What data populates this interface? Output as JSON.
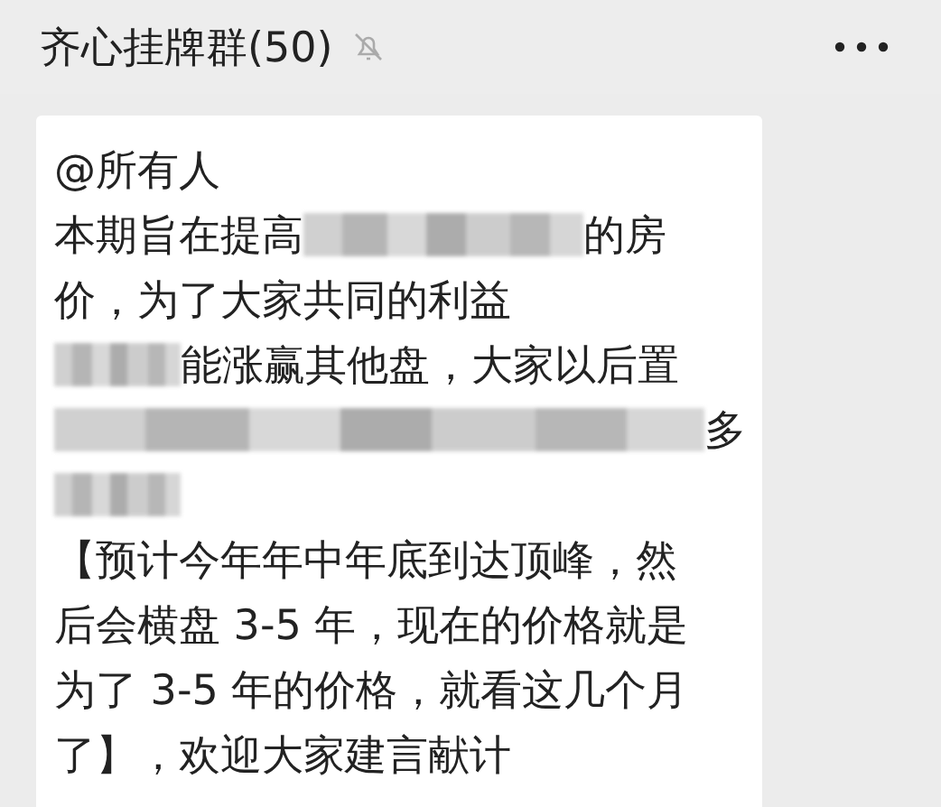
{
  "header": {
    "title": "齐心挂牌群(50)",
    "muted": true
  },
  "message": {
    "lines": [
      [
        {
          "kind": "text",
          "text": "@所有人"
        }
      ],
      [
        {
          "kind": "text",
          "text": "本期旨在提高"
        },
        {
          "kind": "longblur"
        },
        {
          "kind": "text",
          "text": "的房"
        }
      ],
      [
        {
          "kind": "text",
          "text": "价，为了大家共同的利益"
        }
      ],
      [
        {
          "kind": "blur"
        },
        {
          "kind": "text",
          "text": "能涨赢其他盘，大家以后置"
        }
      ],
      [
        {
          "kind": "fullblur"
        },
        {
          "kind": "text",
          "text": "多"
        }
      ],
      [
        {
          "kind": "blur"
        }
      ],
      [
        {
          "kind": "text",
          "text": "【预计今年年中年底到达顶峰，然"
        }
      ],
      [
        {
          "kind": "text",
          "text": "后会横盘 3-5 年，现在的价格就是"
        }
      ],
      [
        {
          "kind": "text",
          "text": "为了 3-5 年的价格，就看这几个月"
        }
      ],
      [
        {
          "kind": "text",
          "text": "了】，欢迎大家建言献计"
        }
      ]
    ]
  }
}
